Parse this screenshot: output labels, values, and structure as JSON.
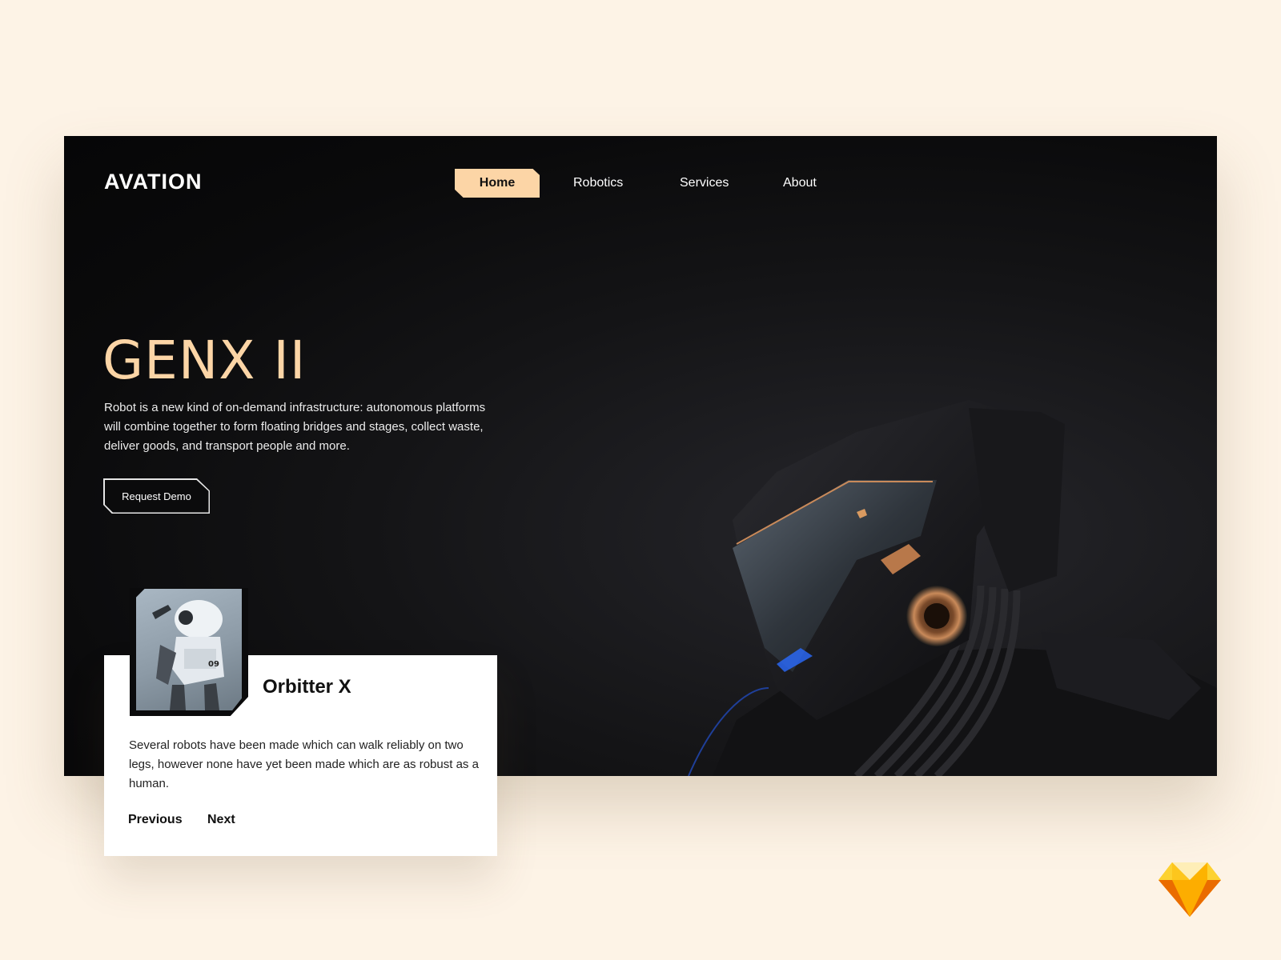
{
  "brand": {
    "logo": "AVATION"
  },
  "nav": {
    "items": [
      {
        "label": "Home",
        "active": true
      },
      {
        "label": "Robotics",
        "active": false
      },
      {
        "label": "Services",
        "active": false
      },
      {
        "label": "About",
        "active": false
      }
    ]
  },
  "hero": {
    "title": "GENX II",
    "description": "Robot is a new kind of on-demand infrastructure: autonomous platforms will combine together to form floating bridges and stages, collect waste, deliver goods, and transport people and more.",
    "cta_label": "Request Demo"
  },
  "card": {
    "title": "Orbitter X",
    "description": "Several robots have been made which can walk reliably on two legs, however none have yet been made which are as robust as a human.",
    "thumb_badge": "09",
    "prev_label": "Previous",
    "next_label": "Next"
  },
  "colors": {
    "page_background": "#fdf3e6",
    "accent": "#fcd5a6",
    "hero_background": "#0a0a0b",
    "card_background": "#ffffff"
  },
  "icons": {
    "sketch": "sketch-diamond-icon"
  }
}
